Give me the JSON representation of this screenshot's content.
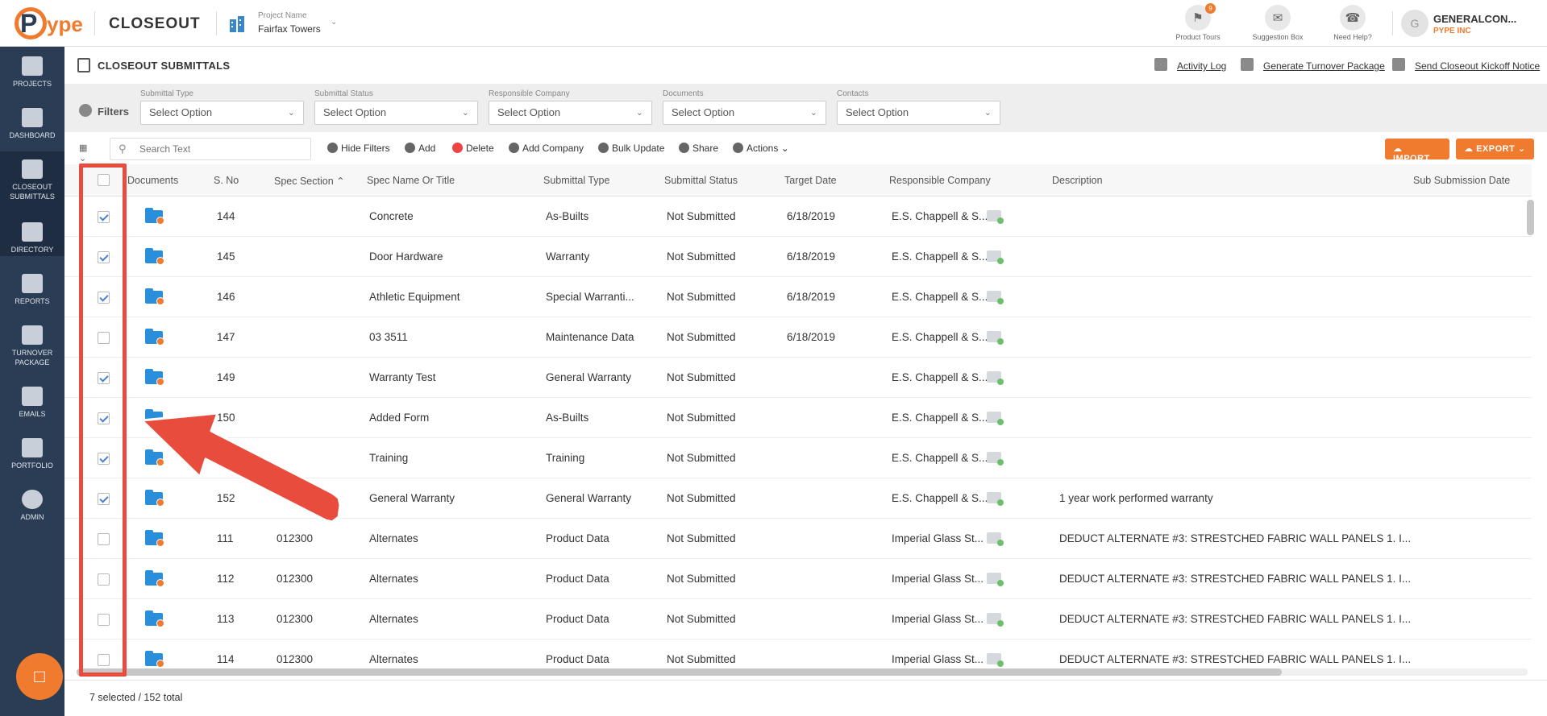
{
  "header": {
    "logo_p": "P",
    "logo_ype": "ype",
    "app_title": "CLOSEOUT",
    "project_label": "Project Name",
    "project_name": "Fairfax Towers",
    "tools": [
      {
        "label": "Product Tours",
        "badge": "9"
      },
      {
        "label": "Suggestion Box",
        "badge": ""
      },
      {
        "label": "Need Help?",
        "badge": ""
      }
    ],
    "user_initial": "G",
    "user_name": "GENERALCON...",
    "user_company": "PYPE INC"
  },
  "sidebar": {
    "items": [
      {
        "label": "PROJECTS"
      },
      {
        "label": "DASHBOARD"
      },
      {
        "label": "CLOSEOUT SUBMITTALS"
      },
      {
        "label": "DIRECTORY"
      },
      {
        "label": "REPORTS"
      },
      {
        "label": "TURNOVER PACKAGE"
      },
      {
        "label": "EMAILS"
      },
      {
        "label": "PORTFOLIO"
      },
      {
        "label": "ADMIN"
      }
    ]
  },
  "page": {
    "title": "CLOSEOUT SUBMITTALS",
    "links": [
      "Activity Log",
      "Generate Turnover Package",
      "Send Closeout Kickoff Notice"
    ]
  },
  "filters": {
    "title": "Filters",
    "groups": [
      {
        "label": "Submittal Type",
        "value": "Select Option"
      },
      {
        "label": "Submittal Status",
        "value": "Select Option"
      },
      {
        "label": "Responsible Company",
        "value": "Select Option"
      },
      {
        "label": "Documents",
        "value": "Select Option"
      },
      {
        "label": "Contacts",
        "value": "Select Option"
      }
    ]
  },
  "toolbar": {
    "search_placeholder": "Search Text",
    "hide_filters": "Hide Filters",
    "add": "Add",
    "delete": "Delete",
    "add_company": "Add Company",
    "bulk_update": "Bulk Update",
    "share": "Share",
    "actions": "Actions",
    "import": "IMPORT",
    "export": "EXPORT"
  },
  "table": {
    "columns": [
      "Documents",
      "S. No",
      "Spec Section",
      "Spec Name Or Title",
      "Submittal Type",
      "Submittal Status",
      "Target Date",
      "Responsible Company",
      "Description",
      "Sub Submission Date"
    ],
    "rows": [
      {
        "checked": true,
        "sno": "144",
        "spec": "",
        "name": "Concrete",
        "type": "As-Builts",
        "status": "Not Submitted",
        "date": "6/18/2019",
        "company": "E.S. Chappell & S...",
        "desc": ""
      },
      {
        "checked": true,
        "sno": "145",
        "spec": "",
        "name": "Door Hardware",
        "type": "Warranty",
        "status": "Not Submitted",
        "date": "6/18/2019",
        "company": "E.S. Chappell & S...",
        "desc": ""
      },
      {
        "checked": true,
        "sno": "146",
        "spec": "",
        "name": "Athletic Equipment",
        "type": "Special Warranti...",
        "status": "Not Submitted",
        "date": "6/18/2019",
        "company": "E.S. Chappell & S...",
        "desc": ""
      },
      {
        "checked": false,
        "sno": "147",
        "spec": "",
        "name": "03 3511",
        "type": "Maintenance Data",
        "status": "Not Submitted",
        "date": "6/18/2019",
        "company": "E.S. Chappell & S...",
        "desc": ""
      },
      {
        "checked": true,
        "sno": "149",
        "spec": "",
        "name": "Warranty Test",
        "type": "General Warranty",
        "status": "Not Submitted",
        "date": "",
        "company": "E.S. Chappell & S...",
        "desc": ""
      },
      {
        "checked": true,
        "sno": "150",
        "spec": "",
        "name": "Added Form",
        "type": "As-Builts",
        "status": "Not Submitted",
        "date": "",
        "company": "E.S. Chappell & S...",
        "desc": ""
      },
      {
        "checked": true,
        "sno": "",
        "spec": "",
        "name": "Training",
        "type": "Training",
        "status": "Not Submitted",
        "date": "",
        "company": "E.S. Chappell & S...",
        "desc": ""
      },
      {
        "checked": true,
        "sno": "152",
        "spec": "",
        "name": "General Warranty",
        "type": "General Warranty",
        "status": "Not Submitted",
        "date": "",
        "company": "E.S. Chappell & S...",
        "desc": "1 year work performed warranty"
      },
      {
        "checked": false,
        "sno": "111",
        "spec": "012300",
        "name": "Alternates",
        "type": "Product Data",
        "status": "Not Submitted",
        "date": "",
        "company": "Imperial Glass St...",
        "desc": "DEDUCT ALTERNATE #3: STRESTCHED FABRIC WALL PANELS 1. I..."
      },
      {
        "checked": false,
        "sno": "112",
        "spec": "012300",
        "name": "Alternates",
        "type": "Product Data",
        "status": "Not Submitted",
        "date": "",
        "company": "Imperial Glass St...",
        "desc": "DEDUCT ALTERNATE #3: STRESTCHED FABRIC WALL PANELS 1. I..."
      },
      {
        "checked": false,
        "sno": "113",
        "spec": "012300",
        "name": "Alternates",
        "type": "Product Data",
        "status": "Not Submitted",
        "date": "",
        "company": "Imperial Glass St...",
        "desc": "DEDUCT ALTERNATE #3: STRESTCHED FABRIC WALL PANELS 1. I..."
      },
      {
        "checked": false,
        "sno": "114",
        "spec": "012300",
        "name": "Alternates",
        "type": "Product Data",
        "status": "Not Submitted",
        "date": "",
        "company": "Imperial Glass St...",
        "desc": "DEDUCT ALTERNATE #3: STRESTCHED FABRIC WALL PANELS 1. I..."
      }
    ]
  },
  "footer": {
    "selection": "7 selected / 152 total"
  },
  "colors": {
    "brand_orange": "#f07a2d",
    "sidebar": "#2b3c55",
    "annotation_red": "#e84c3d",
    "folder_blue": "#2a8fdb"
  }
}
